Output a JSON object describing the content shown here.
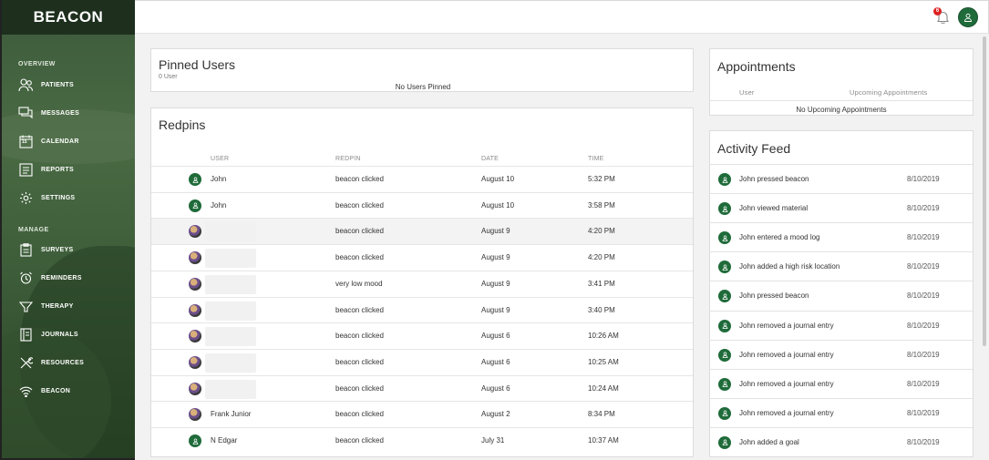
{
  "brand": "BEACON",
  "sidebar": {
    "sections": [
      {
        "label": "OVERVIEW",
        "items": [
          {
            "label": "PATIENTS",
            "icon": "patients-icon"
          },
          {
            "label": "MESSAGES",
            "icon": "messages-icon"
          },
          {
            "label": "CALENDAR",
            "icon": "calendar-icon"
          },
          {
            "label": "REPORTS",
            "icon": "reports-icon"
          },
          {
            "label": "SETTINGS",
            "icon": "settings-icon"
          }
        ]
      },
      {
        "label": "MANAGE",
        "items": [
          {
            "label": "SURVEYS",
            "icon": "surveys-icon"
          },
          {
            "label": "REMINDERS",
            "icon": "alarm-clock-icon"
          },
          {
            "label": "THERAPY",
            "icon": "therapy-icon"
          },
          {
            "label": "JOURNALS",
            "icon": "journals-icon"
          },
          {
            "label": "RESOURCES",
            "icon": "tools-icon"
          },
          {
            "label": "BEACON",
            "icon": "wifi-icon"
          }
        ]
      }
    ],
    "calendar_icon_text": "15"
  },
  "topbar": {
    "notification_count": "6"
  },
  "pinned": {
    "title": "Pinned Users",
    "count_label": "0 User",
    "empty": "No Users Pinned"
  },
  "redpins": {
    "title": "Redpins",
    "columns": [
      "USER",
      "REDPIN",
      "DATE",
      "TIME"
    ],
    "rows": [
      {
        "user": "John",
        "redpin": "beacon clicked",
        "date": "August 10",
        "time": "5:32 PM",
        "avatar": "green",
        "highlight": false
      },
      {
        "user": "John",
        "redpin": "beacon clicked",
        "date": "August 10",
        "time": "3:58 PM",
        "avatar": "green",
        "highlight": false
      },
      {
        "user": "",
        "redpin": "beacon clicked",
        "date": "August 9",
        "time": "4:20 PM",
        "avatar": "photo",
        "highlight": true
      },
      {
        "user": "",
        "redpin": "beacon clicked",
        "date": "August 9",
        "time": "4:20 PM",
        "avatar": "photo",
        "highlight": false
      },
      {
        "user": "",
        "redpin": "very low mood",
        "date": "August 9",
        "time": "3:41 PM",
        "avatar": "photo",
        "highlight": false
      },
      {
        "user": "",
        "redpin": "beacon clicked",
        "date": "August 9",
        "time": "3:40 PM",
        "avatar": "photo",
        "highlight": false
      },
      {
        "user": "",
        "redpin": "beacon clicked",
        "date": "August 6",
        "time": "10:26 AM",
        "avatar": "photo",
        "highlight": false
      },
      {
        "user": "",
        "redpin": "beacon clicked",
        "date": "August 6",
        "time": "10:25 AM",
        "avatar": "photo",
        "highlight": false
      },
      {
        "user": "",
        "redpin": "beacon clicked",
        "date": "August 6",
        "time": "10:24 AM",
        "avatar": "photo",
        "highlight": false
      },
      {
        "user": "Frank Junior",
        "redpin": "beacon clicked",
        "date": "August 2",
        "time": "8:34 PM",
        "avatar": "photo",
        "highlight": false
      },
      {
        "user": "N Edgar",
        "redpin": "beacon clicked",
        "date": "July 31",
        "time": "10:37 AM",
        "avatar": "green",
        "highlight": false
      }
    ]
  },
  "appointments": {
    "title": "Appointments",
    "col_user": "User",
    "col_upcoming": "Upcoming Appointments",
    "empty": "No Upcoming Appointments"
  },
  "activity": {
    "title": "Activity Feed",
    "items": [
      {
        "text": "John pressed beacon",
        "date": "8/10/2019"
      },
      {
        "text": "John viewed material",
        "date": "8/10/2019"
      },
      {
        "text": "John entered a mood log",
        "date": "8/10/2019"
      },
      {
        "text": "John added a high risk location",
        "date": "8/10/2019"
      },
      {
        "text": "John pressed beacon",
        "date": "8/10/2019"
      },
      {
        "text": "John removed a journal entry",
        "date": "8/10/2019"
      },
      {
        "text": "John removed a journal entry",
        "date": "8/10/2019"
      },
      {
        "text": "John removed a journal entry",
        "date": "8/10/2019"
      },
      {
        "text": "John removed a journal entry",
        "date": "8/10/2019"
      },
      {
        "text": "John added a goal",
        "date": "8/10/2019"
      }
    ]
  },
  "colors": {
    "brand_green": "#1f6b3a",
    "sidebar": "#3f5f3b",
    "badge_red": "#dd2222"
  }
}
